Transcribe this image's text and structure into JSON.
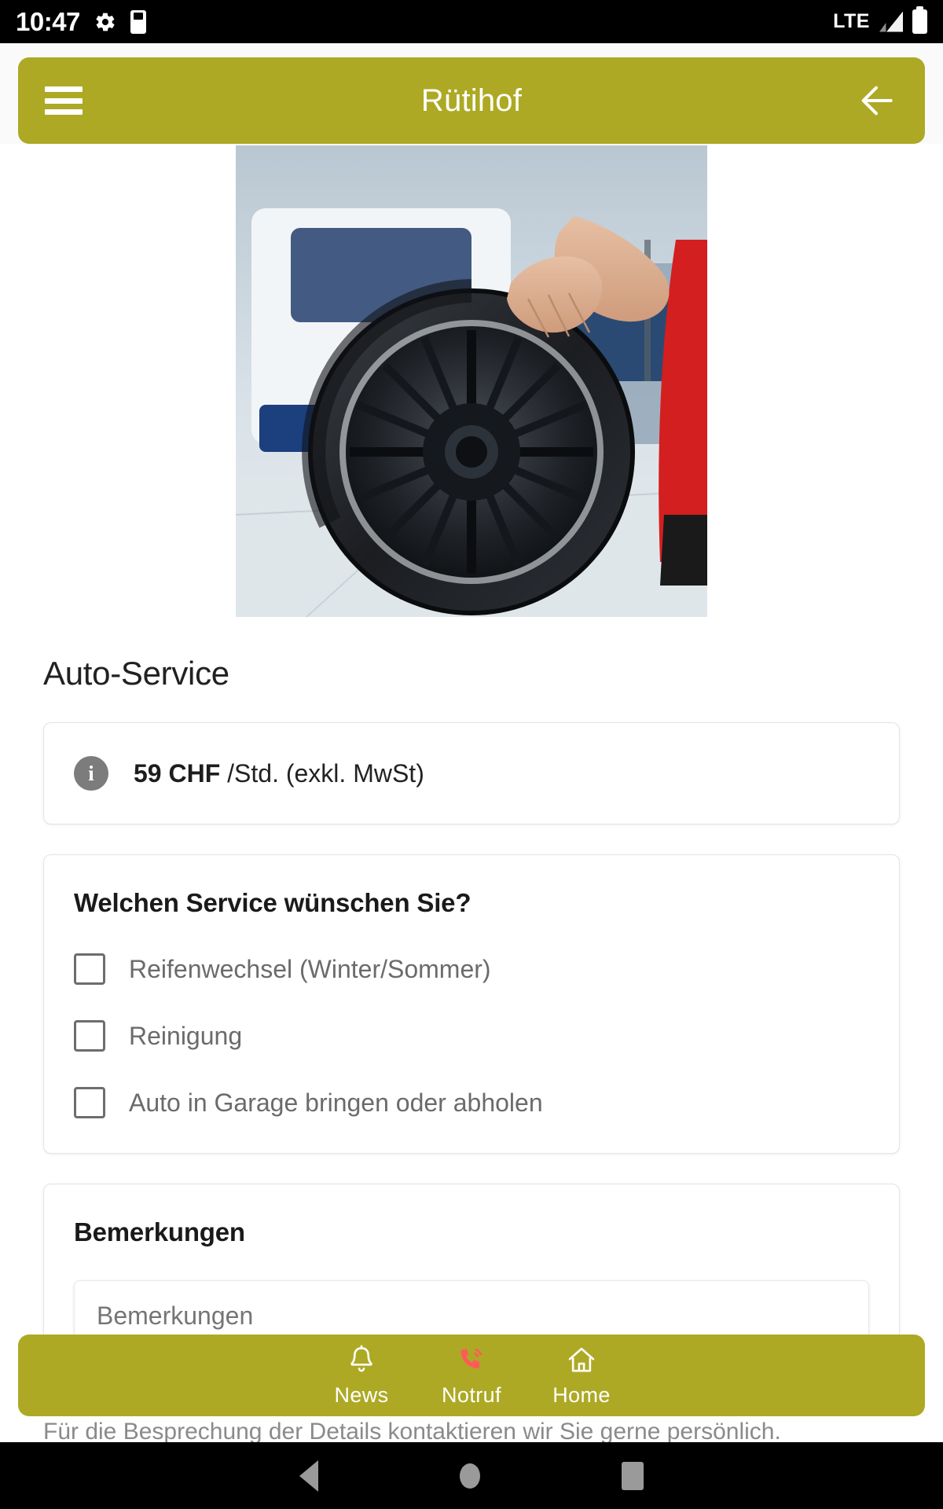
{
  "statusbar": {
    "time": "10:47",
    "network": "LTE",
    "icons": [
      "gear-icon",
      "sd-card-icon",
      "signal-icon",
      "battery-icon"
    ]
  },
  "appbar": {
    "title": "Rütihof",
    "menu_icon": "hamburger-menu-icon",
    "back_icon": "arrow-left-icon",
    "color": "#ADA925"
  },
  "hero": {
    "alt": "Mechanic holding a car tire with black alloy rim in a garage"
  },
  "page": {
    "title": "Auto-Service"
  },
  "price": {
    "info_icon": "info-icon",
    "amount": "59 CHF",
    "unit": " /Std. (exkl. MwSt)"
  },
  "service": {
    "heading": "Welchen Service wünschen Sie?",
    "options": [
      {
        "label": "Reifenwechsel (Winter/Sommer)",
        "checked": false
      },
      {
        "label": "Reinigung",
        "checked": false
      },
      {
        "label": "Auto in Garage bringen oder abholen",
        "checked": false
      }
    ]
  },
  "remarks": {
    "heading": "Bemerkungen",
    "placeholder": "Bemerkungen",
    "value": ""
  },
  "note": {
    "text": "Für die Besprechung der Details kontaktieren wir Sie gerne persönlich."
  },
  "bottomnav": {
    "color": "#ADA925",
    "items": [
      {
        "label": "News",
        "icon": "bell-icon",
        "color": "#ffffff"
      },
      {
        "label": "Notruf",
        "icon": "emergency-call-icon",
        "color": "#FF5A5A"
      },
      {
        "label": "Home",
        "icon": "home-icon",
        "color": "#ffffff"
      }
    ]
  },
  "androidnav": {
    "back": "back-triangle-icon",
    "home": "home-circle-icon",
    "recents": "recents-square-icon"
  }
}
